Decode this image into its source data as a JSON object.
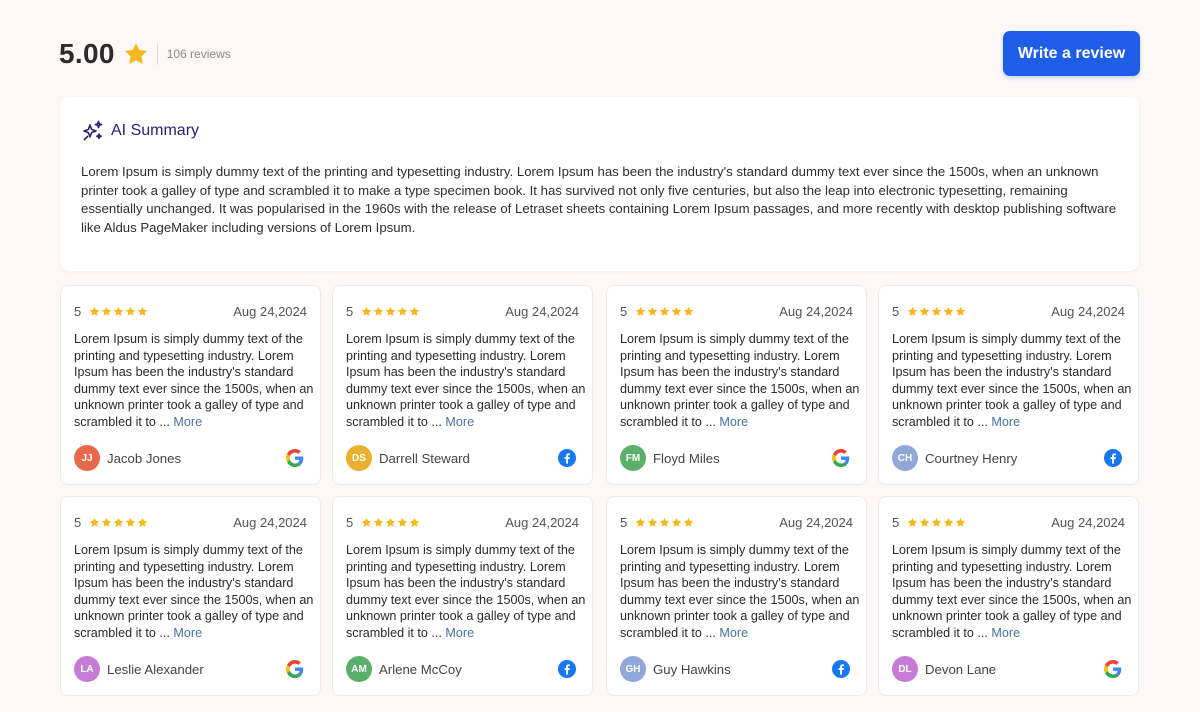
{
  "header": {
    "rating": "5.00",
    "review_count": "106 reviews",
    "write_button": "Write a review"
  },
  "summary": {
    "title": "AI Summary",
    "text": "Lorem Ipsum is simply dummy text of the printing and typesetting industry. Lorem Ipsum has been the industry's standard dummy text ever since the 1500s, when an unknown printer took a galley of type and scrambled it to make a type specimen book. It has survived not only five centuries, but also the leap into electronic typesetting, remaining essentially unchanged. It was popularised in the 1960s with the release of Letraset sheets containing Lorem Ipsum passages, and more recently with desktop publishing software like Aldus PageMaker including versions of Lorem Ipsum."
  },
  "reviews": [
    {
      "score": "5",
      "stars": 5,
      "date": "Aug 24,2024",
      "text": "Lorem Ipsum is simply dummy text of the printing and typesetting industry. Lorem Ipsum has been the industry's standard dummy text ever since the 1500s, when an unknown printer took a galley of type and scrambled it to ... ",
      "more": "More",
      "initials": "JJ",
      "name": "Jacob Jones",
      "avatar_color": "#e8684a",
      "source": "google"
    },
    {
      "score": "5",
      "stars": 5,
      "date": "Aug 24,2024",
      "text": "Lorem Ipsum is simply dummy text of the printing and typesetting industry. Lorem Ipsum has been the industry's standard dummy text ever since the 1500s, when an unknown printer took a galley of type and scrambled it to ... ",
      "more": "More",
      "initials": "DS",
      "name": "Darrell Steward",
      "avatar_color": "#e9b12f",
      "source": "facebook"
    },
    {
      "score": "5",
      "stars": 5,
      "date": "Aug 24,2024",
      "text": "Lorem Ipsum is simply dummy text of the printing and typesetting industry. Lorem Ipsum has been the industry's standard dummy text ever since the 1500s, when an unknown printer took a galley of type and scrambled it to ... ",
      "more": "More",
      "initials": "FM",
      "name": "Floyd Miles",
      "avatar_color": "#5aaf6a",
      "source": "google"
    },
    {
      "score": "5",
      "stars": 5,
      "date": "Aug 24,2024",
      "text": "Lorem Ipsum is simply dummy text of the printing and typesetting industry. Lorem Ipsum has been the industry's standard dummy text ever since the 1500s, when an unknown printer took a galley of type and scrambled it to ... ",
      "more": "More",
      "initials": "CH",
      "name": "Courtney Henry",
      "avatar_color": "#8fa8d8",
      "source": "facebook"
    },
    {
      "score": "5",
      "stars": 5,
      "date": "Aug 24,2024",
      "text": "Lorem Ipsum is simply dummy text of the printing and typesetting industry. Lorem Ipsum has been the industry's standard dummy text ever since the 1500s, when an unknown printer took a galley of type and scrambled it to ... ",
      "more": "More",
      "initials": "LA",
      "name": "Leslie Alexander",
      "avatar_color": "#c67bd4",
      "source": "google"
    },
    {
      "score": "5",
      "stars": 5,
      "date": "Aug 24,2024",
      "text": "Lorem Ipsum is simply dummy text of the printing and typesetting industry. Lorem Ipsum has been the industry's standard dummy text ever since the 1500s, when an unknown printer took a galley of type and scrambled it to ... ",
      "more": "More",
      "initials": "AM",
      "name": "Arlene McCoy",
      "avatar_color": "#5aaf6a",
      "source": "facebook"
    },
    {
      "score": "5",
      "stars": 5,
      "date": "Aug 24,2024",
      "text": "Lorem Ipsum is simply dummy text of the printing and typesetting industry. Lorem Ipsum has been the industry's standard dummy text ever since the 1500s, when an unknown printer took a galley of type and scrambled it to ... ",
      "more": "More",
      "initials": "GH",
      "name": "Guy Hawkins",
      "avatar_color": "#8fa8d8",
      "source": "facebook"
    },
    {
      "score": "5",
      "stars": 5,
      "date": "Aug 24,2024",
      "text": "Lorem Ipsum is simply dummy text of the printing and typesetting industry. Lorem Ipsum has been the industry's standard dummy text ever since the 1500s, when an unknown printer took a galley of type and scrambled it to ... ",
      "more": "More",
      "initials": "DL",
      "name": "Devon Lane",
      "avatar_color": "#c67bd4",
      "source": "google"
    }
  ],
  "colors": {
    "accent": "#1e5ee6",
    "star": "#f5b81c",
    "summary_title": "#2a2170"
  }
}
